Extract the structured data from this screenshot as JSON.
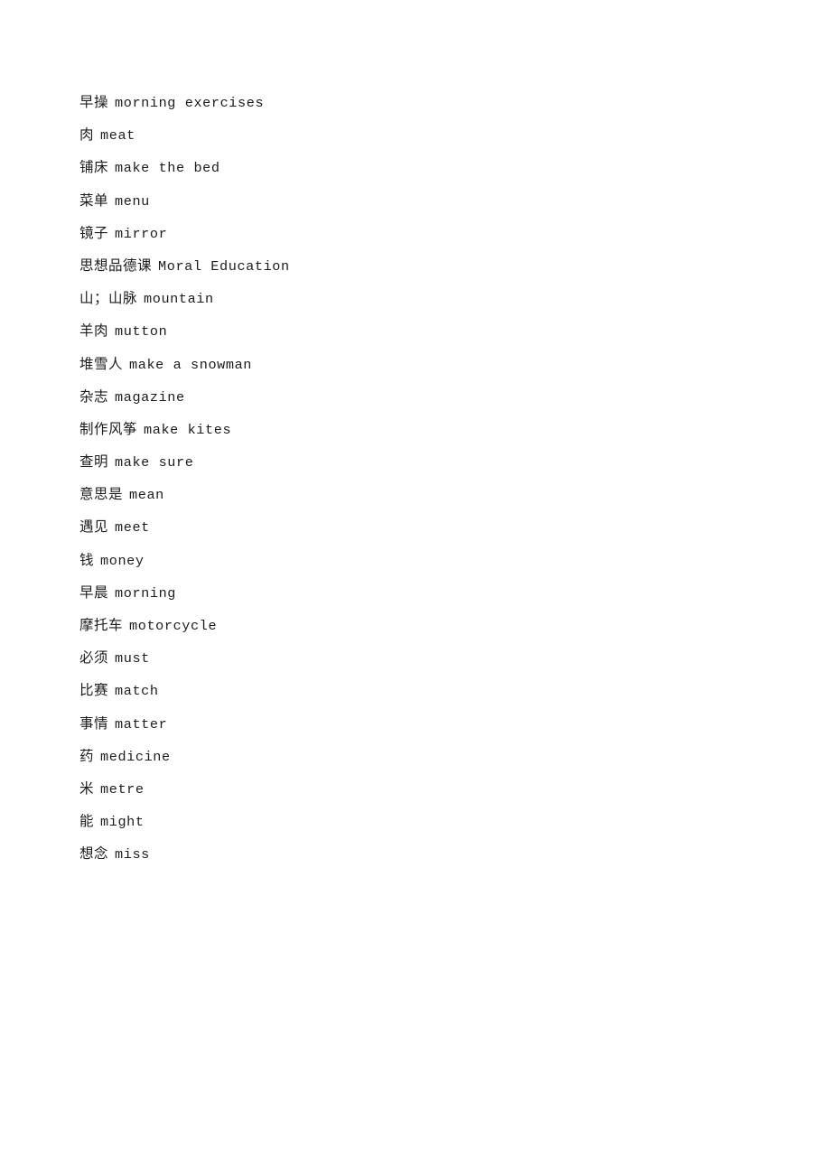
{
  "document": {
    "type": "vocabulary-list",
    "background_color": "#ffffff",
    "text_color": "#1c1c1c",
    "entry_count": 24,
    "entries": [
      {
        "chinese": "早操",
        "english": "morning exercises"
      },
      {
        "chinese": "肉",
        "english": "meat"
      },
      {
        "chinese": "铺床",
        "english": "make the bed"
      },
      {
        "chinese": "菜单",
        "english": "menu"
      },
      {
        "chinese": "镜子",
        "english": "mirror"
      },
      {
        "chinese": "思想品德课",
        "english": "Moral Education"
      },
      {
        "chinese": "山；山脉",
        "english": "mountain"
      },
      {
        "chinese": "羊肉",
        "english": "mutton"
      },
      {
        "chinese": "堆雪人",
        "english": "make a snowman"
      },
      {
        "chinese": "杂志",
        "english": "magazine"
      },
      {
        "chinese": "制作风筝",
        "english": "make kites"
      },
      {
        "chinese": "查明",
        "english": "make sure"
      },
      {
        "chinese": "意思是",
        "english": "mean"
      },
      {
        "chinese": "遇见",
        "english": "meet"
      },
      {
        "chinese": "钱",
        "english": "money"
      },
      {
        "chinese": "早晨",
        "english": "morning"
      },
      {
        "chinese": "摩托车",
        "english": "motorcycle"
      },
      {
        "chinese": "必须",
        "english": "must"
      },
      {
        "chinese": "比赛",
        "english": "match"
      },
      {
        "chinese": "事情",
        "english": "matter"
      },
      {
        "chinese": "药",
        "english": "medicine"
      },
      {
        "chinese": "米",
        "english": "metre"
      },
      {
        "chinese": "能",
        "english": "might"
      },
      {
        "chinese": "想念",
        "english": "miss"
      }
    ]
  }
}
